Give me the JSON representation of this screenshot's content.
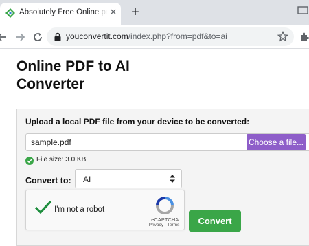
{
  "browser": {
    "tab": {
      "title": "Absolutely Free Online pdf to ai Converter",
      "favicon": "youconvertit-logo-icon"
    },
    "new_tab_label": "+",
    "url_host": "youconvertit.com",
    "url_path": "/index.php?from=pdf&to=ai",
    "icons": [
      "back-arrow-icon",
      "forward-arrow-icon",
      "reload-icon",
      "lock-icon",
      "star-icon",
      "extensions-icon",
      "close-icon"
    ]
  },
  "page": {
    "title": "Online PDF to AI Converter",
    "upload_label": "Upload a local PDF file from your device to be converted:",
    "file_name": "sample.pdf",
    "choose_button": "Choose a file...",
    "file_size": "File size: 3.0 KB",
    "convert_to_label": "Convert to:",
    "convert_to_value": "AI",
    "captcha_text": "I'm not a robot",
    "captcha_brand": "reCAPTCHA",
    "captcha_links": "Privacy - Terms",
    "convert_button": "Convert"
  },
  "colors": {
    "choose_button": "#8e5ec9",
    "convert_button": "#3aa648",
    "checkmark": "#1e8e3e",
    "panel_bg": "#f4f4f4"
  }
}
